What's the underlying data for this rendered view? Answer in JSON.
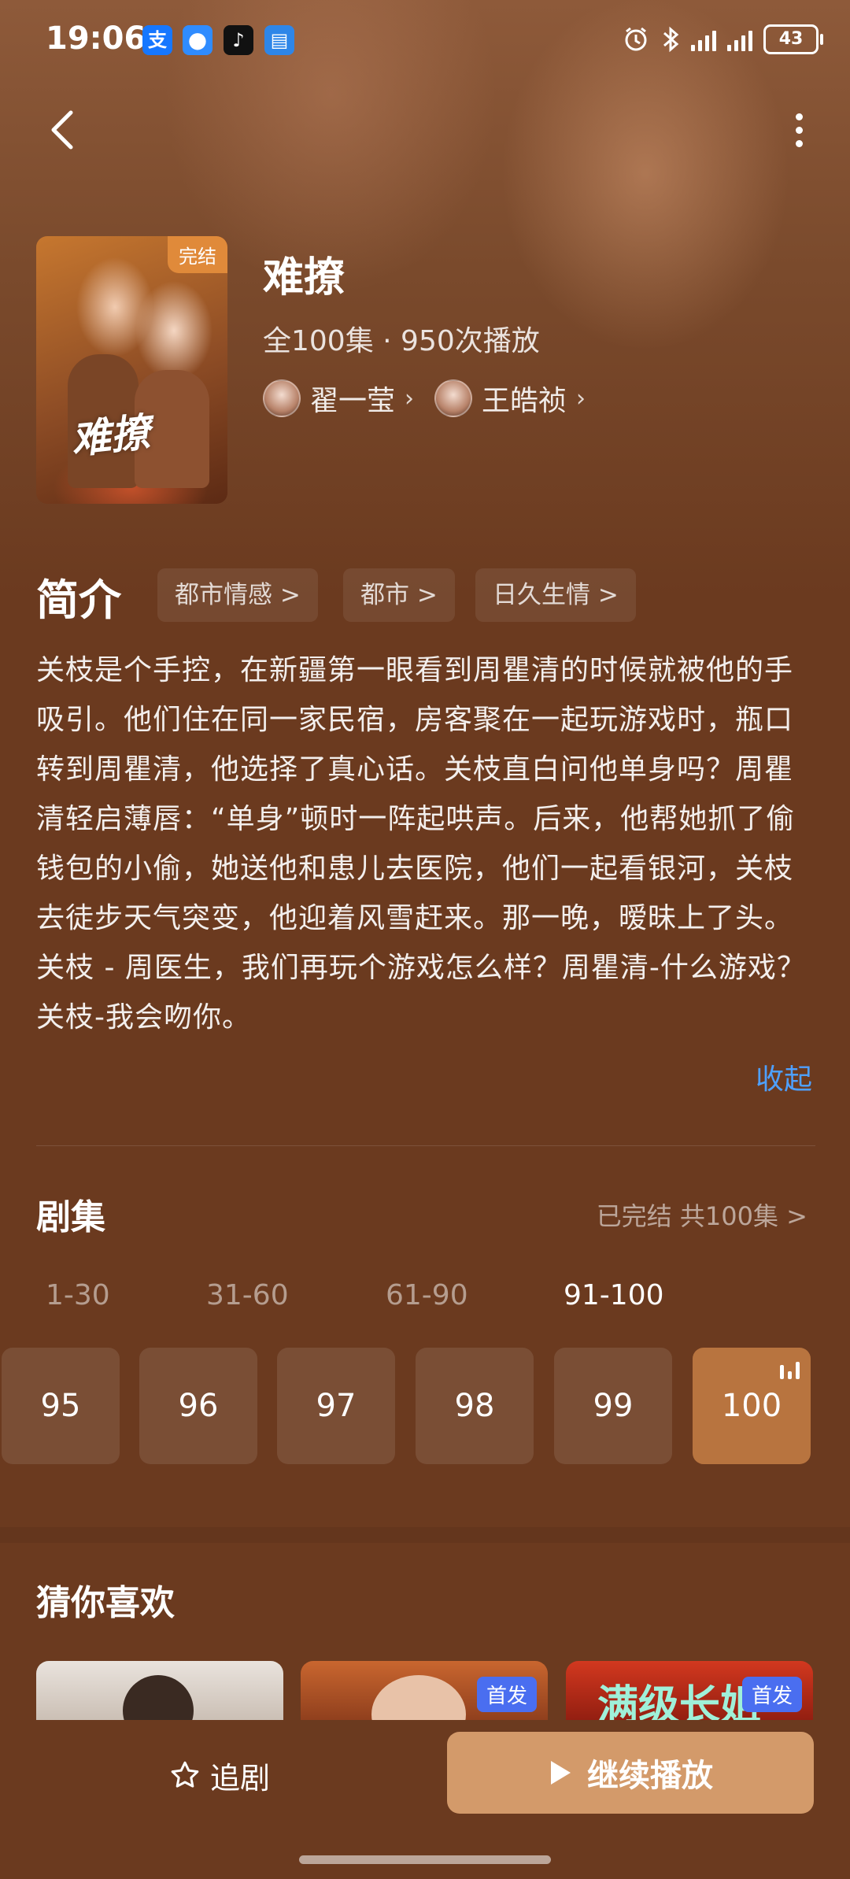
{
  "status_bar": {
    "time": "19:06",
    "battery": "43",
    "apps": [
      {
        "icon": "alipay-icon",
        "glyph": "支",
        "color": "#1677ff"
      },
      {
        "icon": "message-icon",
        "glyph": "●",
        "color": "#2f8cff"
      },
      {
        "icon": "tiktok-icon",
        "glyph": "♪",
        "color": "#111111"
      },
      {
        "icon": "wallet-icon",
        "glyph": "▤",
        "color": "#2e86e8"
      }
    ]
  },
  "drama": {
    "poster_badge": "完结",
    "poster_title": "难撩",
    "title": "难撩",
    "meta": "全100集 · 950次播放",
    "cast": [
      {
        "name": "翟一莹"
      },
      {
        "name": "王皓祯"
      }
    ]
  },
  "intro": {
    "heading": "简介",
    "tags": [
      "都市情感 >",
      "都市 >",
      "日久生情 >"
    ],
    "description": "关枝是个手控，在新疆第一眼看到周瞿清的时候就被他的手吸引。他们住在同一家民宿，房客聚在一起玩游戏时，瓶口转到周瞿清，他选择了真心话。关枝直白问他单身吗？周瞿清轻启薄唇：“单身”顿时一阵起哄声。后来，他帮她抓了偷钱包的小偷，她送他和患儿去医院，他们一起看银河，关枝去徒步天气突变，他迎着风雪赶来。那一晚，暧昧上了头。关枝 - 周医生，我们再玩个游戏怎么样？周瞿清-什么游戏？关枝-我会吻你。",
    "collapse": "收起"
  },
  "episodes": {
    "heading": "剧集",
    "status": "已完结 共100集 >",
    "ranges": [
      "1-30",
      "31-60",
      "61-90",
      "91-100"
    ],
    "active_range": 3,
    "items": [
      "95",
      "96",
      "97",
      "98",
      "99",
      "100"
    ],
    "current": "100"
  },
  "recommend": {
    "heading": "猜你喜欢",
    "badges": [
      "",
      "首发",
      "首发"
    ],
    "card3_text": "满级长姐"
  },
  "bottom": {
    "follow": "追剧",
    "play": "继续播放"
  },
  "colors": {
    "background": "#6b3a1f",
    "accent": "#d39a6a",
    "link": "#4ea0ff",
    "active_episode": "#b8743f"
  }
}
